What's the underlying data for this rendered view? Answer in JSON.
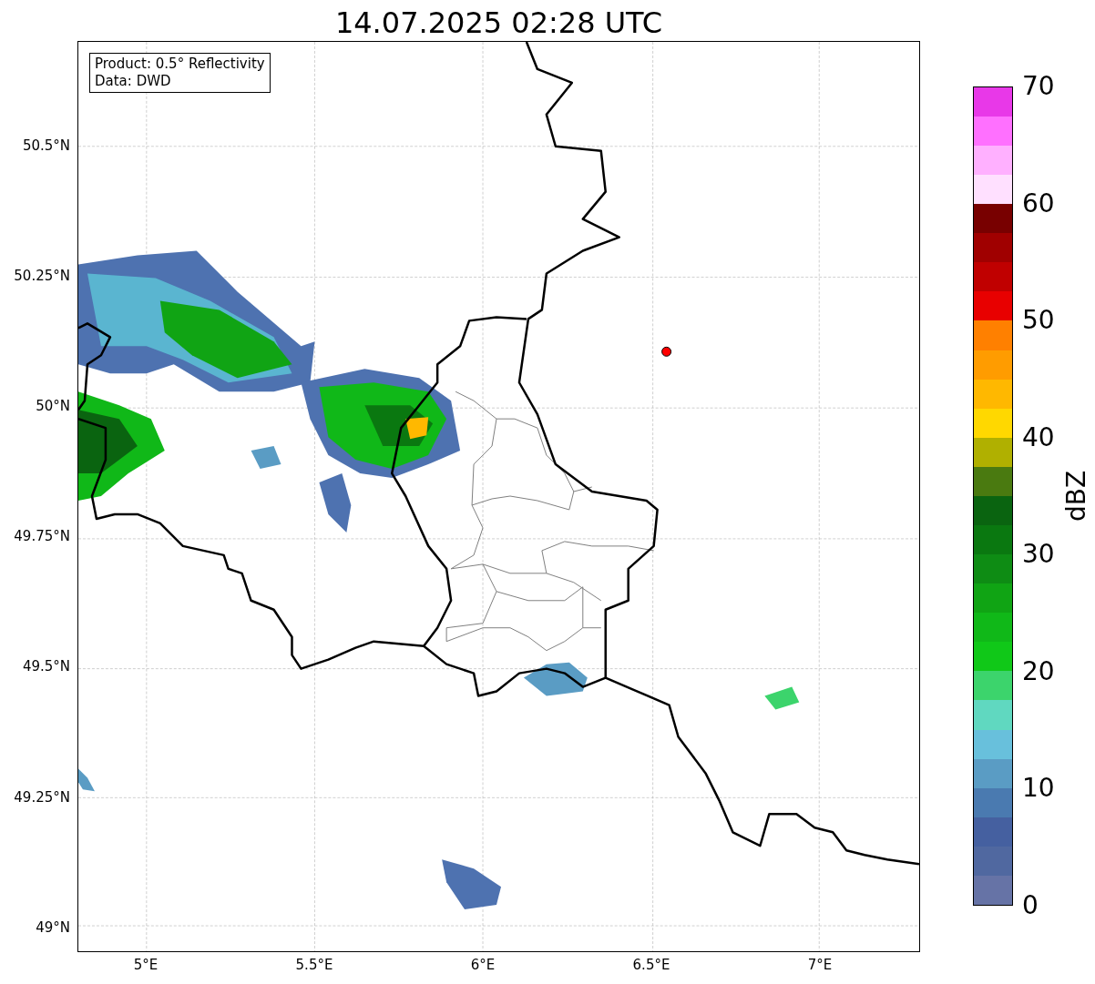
{
  "title": "14.07.2025 02:28 UTC",
  "legend": {
    "lines": [
      "Product: 0.5° Reflectivity",
      "Data: DWD"
    ]
  },
  "y_ticks": [
    "50.5°N",
    "50.25°N",
    "50°N",
    "49.75°N",
    "49.5°N",
    "49.25°N",
    "49°N"
  ],
  "x_ticks": [
    "5°E",
    "5.5°E",
    "6°E",
    "6.5°E",
    "7°E"
  ],
  "colorbar": {
    "label": "dBZ",
    "ticks": [
      "70",
      "60",
      "50",
      "40",
      "30",
      "20",
      "10",
      "0"
    ],
    "bands": [
      {
        "color": "#6673a6"
      },
      {
        "color": "#5068a0"
      },
      {
        "color": "#4560a0"
      },
      {
        "color": "#4a7ab0"
      },
      {
        "color": "#5a9cc4"
      },
      {
        "color": "#68c0dc"
      },
      {
        "color": "#60d8c0"
      },
      {
        "color": "#3cd46c"
      },
      {
        "color": "#10c818"
      },
      {
        "color": "#10b818"
      },
      {
        "color": "#10a414"
      },
      {
        "color": "#0e8c14"
      },
      {
        "color": "#0a7810"
      },
      {
        "color": "#0a6410"
      },
      {
        "color": "#4a7a10"
      },
      {
        "color": "#b0b000"
      },
      {
        "color": "#ffd800"
      },
      {
        "color": "#ffb800"
      },
      {
        "color": "#ff9c00"
      },
      {
        "color": "#ff8000"
      },
      {
        "color": "#e80000"
      },
      {
        "color": "#c00000"
      },
      {
        "color": "#a00000"
      },
      {
        "color": "#780000"
      },
      {
        "color": "#ffe0ff"
      },
      {
        "color": "#ffb0ff"
      },
      {
        "color": "#ff70ff"
      },
      {
        "color": "#e838e8"
      }
    ]
  }
}
